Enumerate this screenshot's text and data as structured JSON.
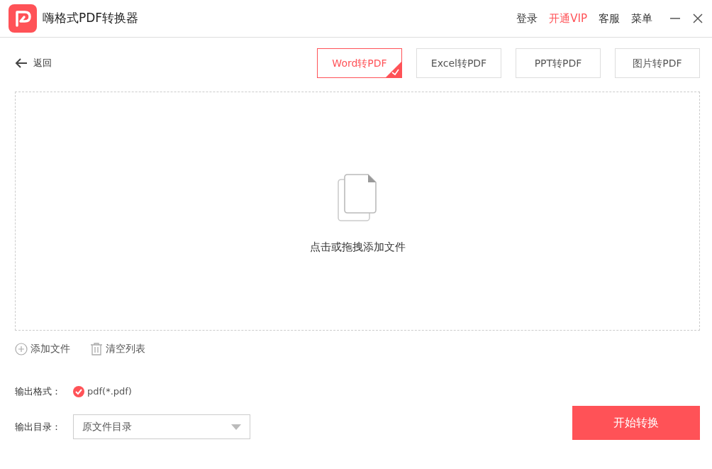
{
  "window": {
    "title": "嗨格式PDF转换器"
  },
  "header_menu": [
    {
      "label": "登录",
      "highlighted": false
    },
    {
      "label": "开通VIP",
      "highlighted": true
    },
    {
      "label": "客服",
      "highlighted": false
    },
    {
      "label": "菜单",
      "highlighted": false
    }
  ],
  "back": {
    "label": "返回"
  },
  "tabs": [
    {
      "label": "Word转PDF",
      "selected": true
    },
    {
      "label": "Excel转PDF",
      "selected": false
    },
    {
      "label": "PPT转PDF",
      "selected": false
    },
    {
      "label": "图片转PDF",
      "selected": false
    }
  ],
  "drop_zone": {
    "hint": "点击或拖拽添加文件"
  },
  "file_actions": [
    {
      "label": "添加文件",
      "kind": "add"
    },
    {
      "label": "清空列表",
      "kind": "clear"
    }
  ],
  "output_format": {
    "label": "输出格式：",
    "value": "pdf(*.pdf)",
    "checked": true
  },
  "output_dir": {
    "label": "输出目录：",
    "value": "原文件目录"
  },
  "start_button": {
    "label": "开始转换"
  }
}
